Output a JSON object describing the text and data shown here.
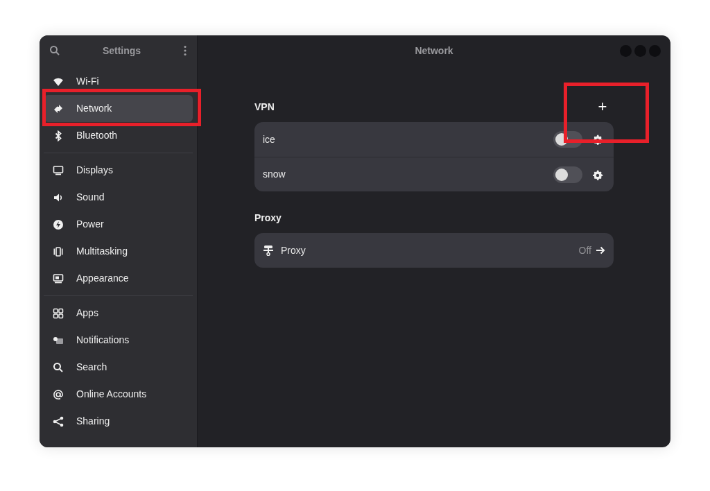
{
  "sidebar": {
    "title": "Settings",
    "groups": [
      [
        {
          "label": "Wi-Fi",
          "selected": false
        },
        {
          "label": "Network",
          "selected": true
        },
        {
          "label": "Bluetooth",
          "selected": false
        }
      ],
      [
        {
          "label": "Displays",
          "selected": false
        },
        {
          "label": "Sound",
          "selected": false
        },
        {
          "label": "Power",
          "selected": false
        },
        {
          "label": "Multitasking",
          "selected": false
        },
        {
          "label": "Appearance",
          "selected": false
        }
      ],
      [
        {
          "label": "Apps",
          "selected": false
        },
        {
          "label": "Notifications",
          "selected": false
        },
        {
          "label": "Search",
          "selected": false
        },
        {
          "label": "Online Accounts",
          "selected": false
        },
        {
          "label": "Sharing",
          "selected": false
        }
      ]
    ]
  },
  "main": {
    "title": "Network",
    "vpn": {
      "heading": "VPN",
      "add_label": "+",
      "connections": [
        {
          "name": "ice",
          "on": false
        },
        {
          "name": "snow",
          "on": false
        }
      ]
    },
    "proxy": {
      "heading": "Proxy",
      "row": {
        "label": "Proxy",
        "value": "Off"
      }
    }
  }
}
